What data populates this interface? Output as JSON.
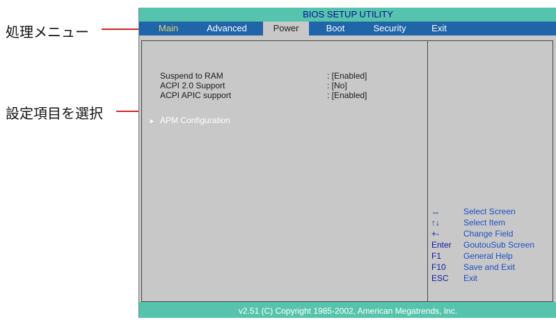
{
  "annotations": {
    "menu_callout": "処理メニュー",
    "select_callout": "設定項目を選択"
  },
  "bios": {
    "title": "BIOS SETUP UTILITY",
    "menu": [
      "Main",
      "Advanced",
      "Power",
      "Boot",
      "Security",
      "Exit"
    ],
    "active_menu": "Power",
    "settings": [
      {
        "name": "Suspend to RAM",
        "value": ": [Enabled]"
      },
      {
        "name": "ACPI 2.0 Support",
        "value": ": [No]"
      },
      {
        "name": "ACPI APIC support",
        "value": ": [Enabled]"
      }
    ],
    "submenu": {
      "arrow": "►",
      "label": "APM Configuration"
    },
    "help": [
      {
        "key": "↔",
        "desc": "Select Screen"
      },
      {
        "key": "↑↓",
        "desc": "Select Item"
      },
      {
        "key": "+-",
        "desc": "Change Field"
      },
      {
        "key": "Enter",
        "desc": "GoutouSub Screen"
      },
      {
        "key": "F1",
        "desc": "General Help"
      },
      {
        "key": "F10",
        "desc": "Save and Exit"
      },
      {
        "key": "ESC",
        "desc": "Exit"
      }
    ],
    "footer": "v2.51 (C) Copyright 1985-2002, American Megatrends, Inc."
  },
  "colors": {
    "accent_teal": "#56c4ac",
    "menu_blue": "#1f65a8",
    "panel_gray": "#c8c8c8",
    "callout_red": "#d0232a"
  }
}
